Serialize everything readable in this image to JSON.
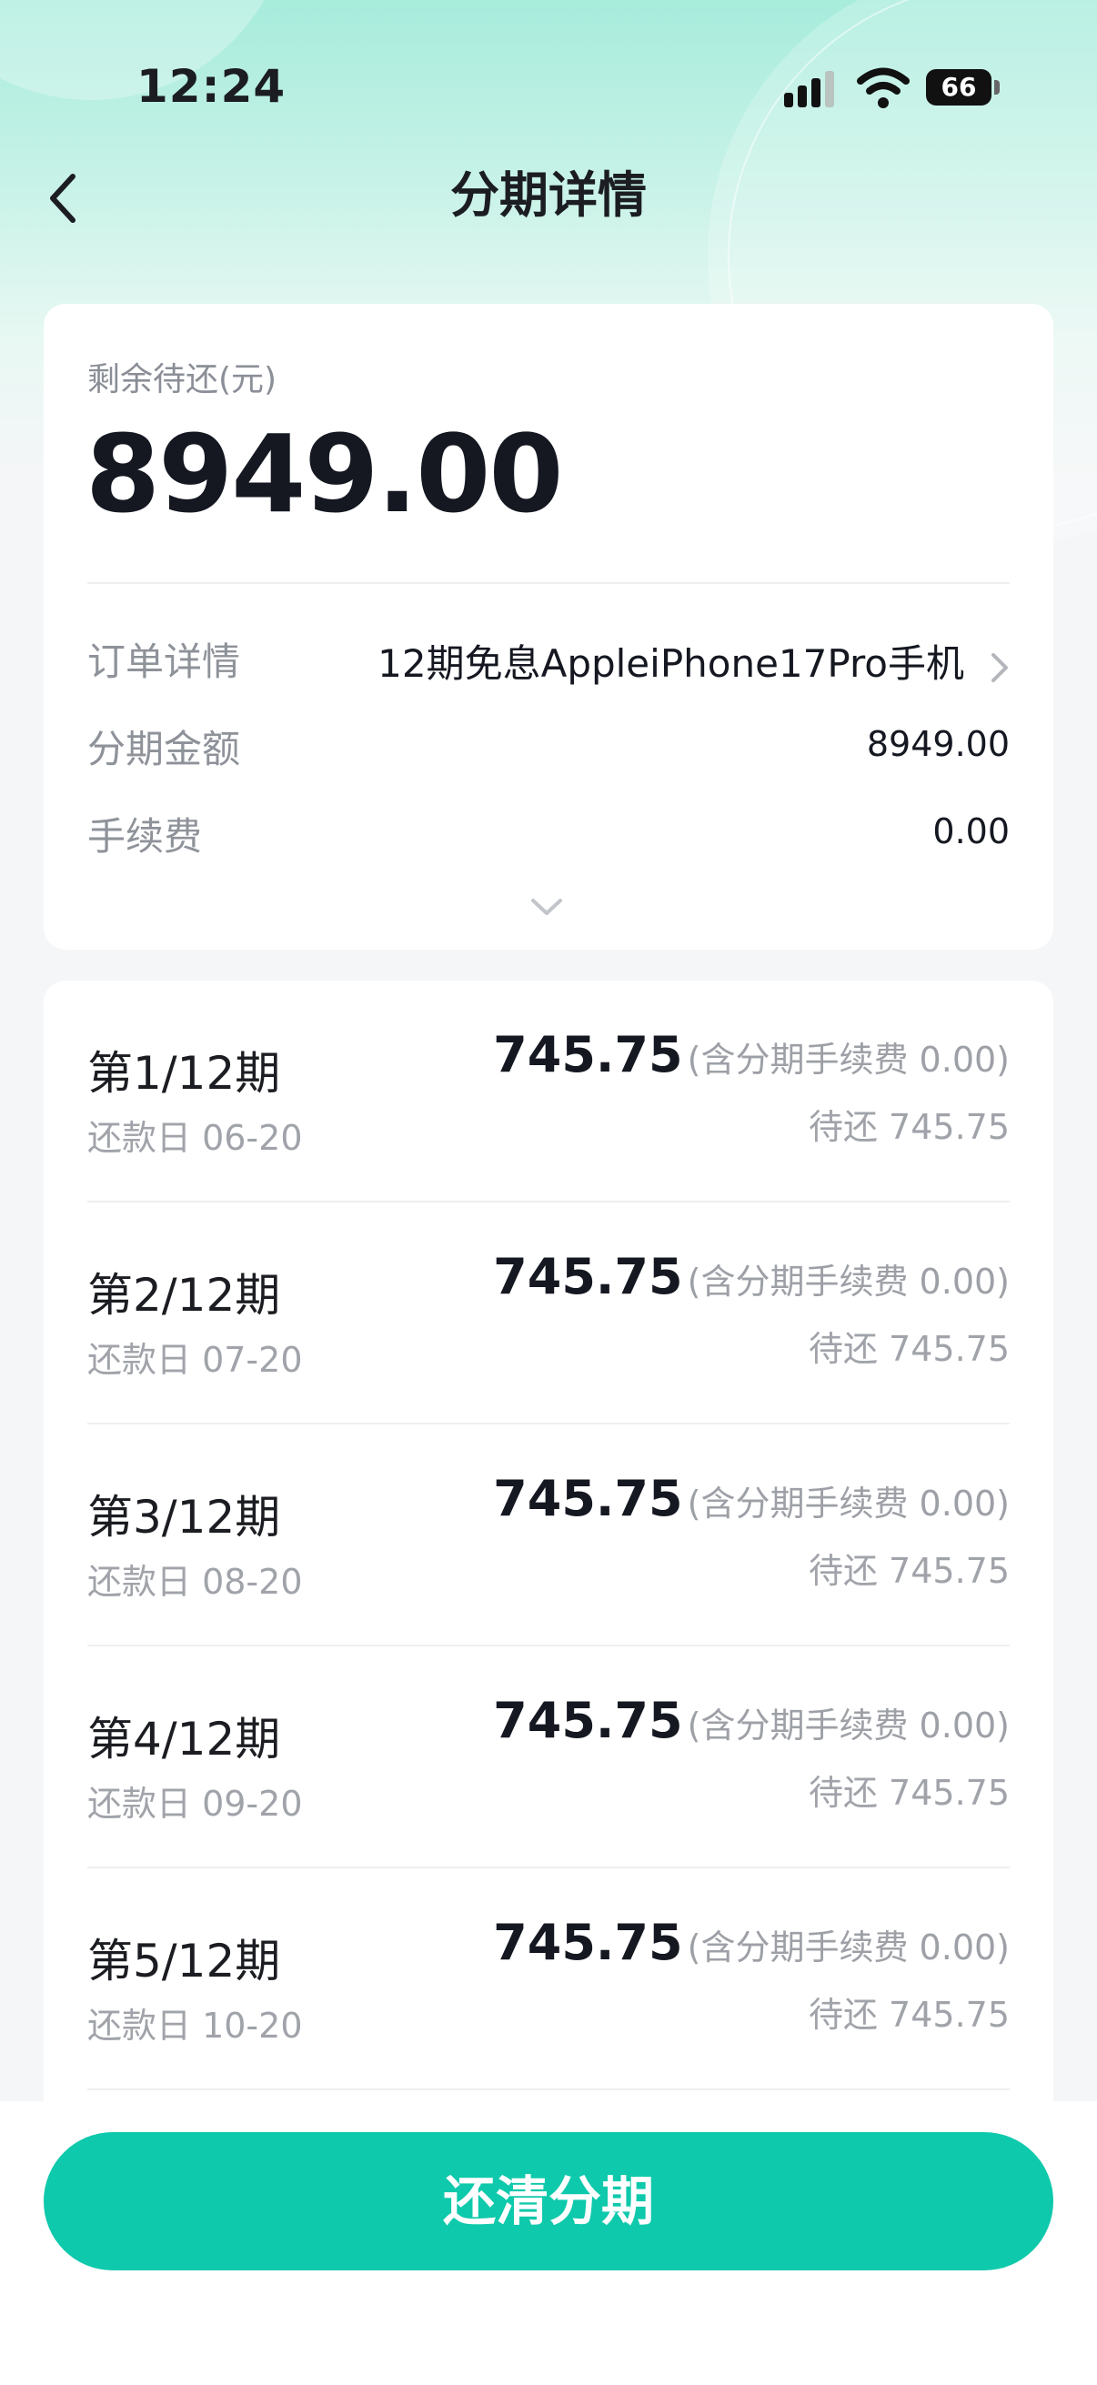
{
  "status_bar": {
    "time": "12:24",
    "battery": "66"
  },
  "nav": {
    "title": "分期详情"
  },
  "summary": {
    "remaining_label": "剩余待还(元)",
    "remaining_amount": "8949.00",
    "rows": [
      {
        "label": "订单详情",
        "value": "12期免息AppleiPhone17Pro手机"
      },
      {
        "label": "分期金额",
        "value": "8949.00"
      },
      {
        "label": "手续费",
        "value": "0.00"
      }
    ]
  },
  "installments": [
    {
      "term": "第1/12期",
      "due": "还款日 06-20",
      "amount": "745.75",
      "fee_note": "(含分期手续费 0.00)",
      "pending": "待还 745.75"
    },
    {
      "term": "第2/12期",
      "due": "还款日 07-20",
      "amount": "745.75",
      "fee_note": "(含分期手续费 0.00)",
      "pending": "待还 745.75"
    },
    {
      "term": "第3/12期",
      "due": "还款日 08-20",
      "amount": "745.75",
      "fee_note": "(含分期手续费 0.00)",
      "pending": "待还 745.75"
    },
    {
      "term": "第4/12期",
      "due": "还款日 09-20",
      "amount": "745.75",
      "fee_note": "(含分期手续费 0.00)",
      "pending": "待还 745.75"
    },
    {
      "term": "第5/12期",
      "due": "还款日 10-20",
      "amount": "745.75",
      "fee_note": "(含分期手续费 0.00)",
      "pending": "待还 745.75"
    }
  ],
  "bottom": {
    "button_label": "还清分期"
  },
  "colors": {
    "accent": "#0ec9ab",
    "header_gradient_top": "#a7ecdc"
  },
  "icons": [
    "signal-icon",
    "wifi-icon",
    "battery-icon",
    "back-arrow-icon",
    "chevron-right-icon",
    "chevron-down-icon"
  ]
}
